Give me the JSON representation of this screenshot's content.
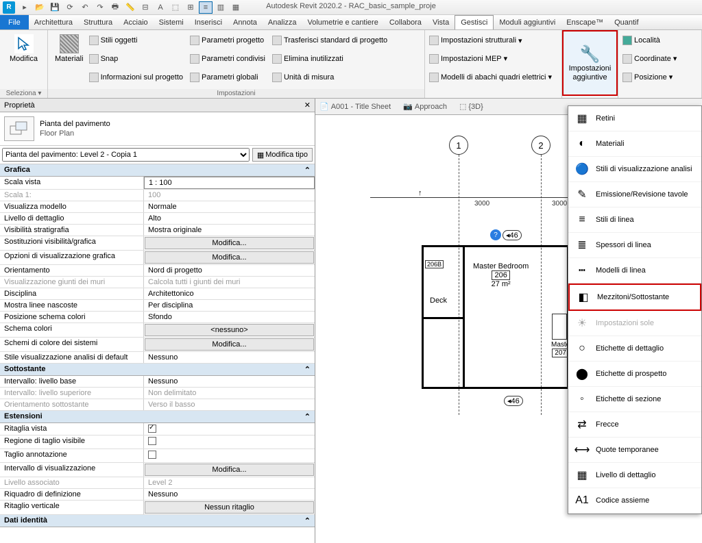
{
  "app_title": "Autodesk Revit 2020.2 - RAC_basic_sample_proje",
  "menu": {
    "file": "File",
    "items": [
      "Architettura",
      "Struttura",
      "Acciaio",
      "Sistemi",
      "Inserisci",
      "Annota",
      "Analizza",
      "Volumetrie e cantiere",
      "Collabora",
      "Vista",
      "Gestisci",
      "Moduli aggiuntivi",
      "Enscape™",
      "Quantif"
    ]
  },
  "ribbon": {
    "modifica": "Modifica",
    "seleziona": "Seleziona",
    "materiali": "Materiali",
    "stili_oggetti": "Stili oggetti",
    "snap": "Snap",
    "info_progetto": "Informazioni sul progetto",
    "param_progetto": "Parametri progetto",
    "param_condivisi": "Parametri condivisi",
    "param_globali": "Parametri  globali",
    "trasf_standard": "Trasferisci standard di progetto",
    "elimina": "Elimina inutilizzati",
    "unita": "Unità di misura",
    "impostazioni": "Impostazioni",
    "imp_strutturali": "Impostazioni strutturali",
    "imp_mep": "Impostazioni MEP",
    "modelli_abachi": "Modelli di abachi quadri elettrici",
    "imp_aggiuntive": "Impostazioni aggiuntive",
    "localita": "Località",
    "coordinate": "Coordinate",
    "posizione": "Posizione"
  },
  "dropdown": [
    {
      "label": "Retini",
      "icon": "▦"
    },
    {
      "label": "Materiali",
      "icon": "◐"
    },
    {
      "label": "Stili di visualizzazione analisi",
      "icon": "🔵",
      "color": "#e74c3c"
    },
    {
      "label": "Emissione/Revisione tavole",
      "icon": "✎"
    },
    {
      "label": "Stili di linea",
      "icon": "≡"
    },
    {
      "label": "Spessori di linea",
      "icon": "≣"
    },
    {
      "label": "Modelli di linea",
      "icon": "┅"
    },
    {
      "label": "Mezzitoni/Sottostante",
      "icon": "◧",
      "highlight": true
    },
    {
      "label": "Impostazioni sole",
      "icon": "☀",
      "disabled": true
    },
    {
      "label": "Etichette di dettaglio",
      "icon": "○"
    },
    {
      "label": "Etichette di prospetto",
      "icon": "⬤"
    },
    {
      "label": "Etichette di sezione",
      "icon": "◦"
    },
    {
      "label": "Frecce",
      "icon": "⇄"
    },
    {
      "label": "Quote temporanee",
      "icon": "⟷"
    },
    {
      "label": "Livello di dettaglio",
      "icon": "▦"
    },
    {
      "label": "Codice assieme",
      "icon": "A1"
    }
  ],
  "view_tabs": [
    {
      "label": "A001 - Title Sheet"
    },
    {
      "label": "Approach"
    },
    {
      "label": "{3D}"
    }
  ],
  "properties": {
    "title": "Proprietà",
    "type_name": "Pianta del pavimento",
    "type_sub": "Floor Plan",
    "instance": "Pianta del pavimento: Level 2 - Copia 1",
    "edit_type": "Modifica tipo",
    "groups": [
      {
        "title": "Grafica",
        "rows": [
          {
            "n": "Scala vista",
            "v": "1 : 100",
            "box": true
          },
          {
            "n": "Scala  1:",
            "v": "100",
            "readonly": true
          },
          {
            "n": "Visualizza modello",
            "v": "Normale"
          },
          {
            "n": "Livello di dettaglio",
            "v": "Alto"
          },
          {
            "n": "Visibilità stratigrafia",
            "v": "Mostra originale"
          },
          {
            "n": "Sostituzioni visibilità/grafica",
            "v": "Modifica...",
            "btn": true
          },
          {
            "n": "Opzioni di visualizzazione grafica",
            "v": "Modifica...",
            "btn": true
          },
          {
            "n": "Orientamento",
            "v": "Nord di progetto"
          },
          {
            "n": "Visualizzazione giunti dei muri",
            "v": "Calcola tutti i giunti dei muri",
            "readonly": true
          },
          {
            "n": "Disciplina",
            "v": "Architettonico"
          },
          {
            "n": "Mostra linee nascoste",
            "v": "Per disciplina"
          },
          {
            "n": "Posizione schema colori",
            "v": "Sfondo"
          },
          {
            "n": "Schema colori",
            "v": "<nessuno>",
            "btn": true
          },
          {
            "n": "Schemi di colore dei sistemi",
            "v": "Modifica...",
            "btn": true
          },
          {
            "n": "Stile visualizzazione analisi di default",
            "v": "Nessuno"
          }
        ]
      },
      {
        "title": "Sottostante",
        "rows": [
          {
            "n": "Intervallo: livello base",
            "v": "Nessuno"
          },
          {
            "n": "Intervallo: livello superiore",
            "v": "Non delimitato",
            "readonly": true
          },
          {
            "n": "Orientamento sottostante",
            "v": "Verso il basso",
            "readonly": true
          }
        ]
      },
      {
        "title": "Estensioni",
        "rows": [
          {
            "n": "Ritaglia vista",
            "v": "",
            "check": true,
            "checked": true
          },
          {
            "n": "Regione di taglio visibile",
            "v": "",
            "check": true
          },
          {
            "n": "Taglio annotazione",
            "v": "",
            "check": true
          },
          {
            "n": "Intervallo di visualizzazione",
            "v": "Modifica...",
            "btn": true
          },
          {
            "n": "Livello associato",
            "v": "Level 2",
            "readonly": true
          },
          {
            "n": "Riquadro di definizione",
            "v": "Nessuno"
          },
          {
            "n": "Ritaglio verticale",
            "v": "Nessun ritaglio",
            "btn": true
          }
        ]
      },
      {
        "title": "Dati identità",
        "rows": []
      }
    ]
  },
  "drawing": {
    "grids": [
      "1",
      "2"
    ],
    "dims": [
      "3000",
      "3000"
    ],
    "rooms": [
      {
        "name": "Master Bedroom",
        "tag": "206",
        "area": "27 m²"
      },
      {
        "name": "Deck",
        "tag": "",
        "area": ""
      },
      {
        "name": "Maste",
        "tag": "207",
        "area": ""
      }
    ],
    "door_tag": "206B",
    "elev_tags": [
      "46",
      "46"
    ]
  }
}
